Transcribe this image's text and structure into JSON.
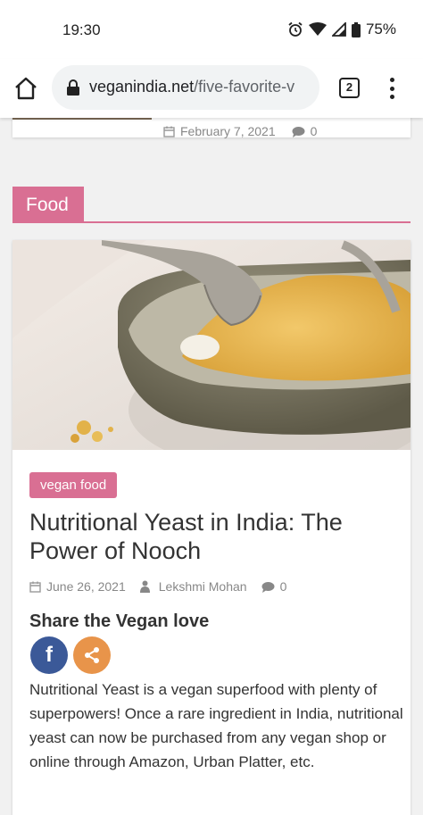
{
  "status_bar": {
    "time": "19:30",
    "battery": "75%"
  },
  "browser": {
    "url_domain": "veganindia.net",
    "url_path": "/five-favorite-v",
    "tab_count": "2"
  },
  "prev_post": {
    "date": "February 7, 2021",
    "comments": "0"
  },
  "section": {
    "label": "Food"
  },
  "article": {
    "category": "vegan food",
    "title": "Nutritional Yeast in India: The Power of Nooch",
    "date": "June 26, 2021",
    "author": "Lekshmi Mohan",
    "comments": "0",
    "share_heading": "Share the Vegan love",
    "excerpt": "Nutritional Yeast is a vegan superfood with plenty of superpowers! Once a rare ingredient in India, nutritional yeast can now be purchased from any vegan shop or online through Amazon, Urban Platter, etc."
  },
  "colors": {
    "accent": "#d96f93",
    "facebook": "#3b5998",
    "share": "#e8944a"
  },
  "icons": [
    "alarm-icon",
    "wifi-icon",
    "signal-icon",
    "battery-icon",
    "home-icon",
    "lock-icon",
    "tabs-icon",
    "menu-icon",
    "calendar-icon",
    "user-icon",
    "comment-icon",
    "facebook-icon",
    "share-icon"
  ]
}
